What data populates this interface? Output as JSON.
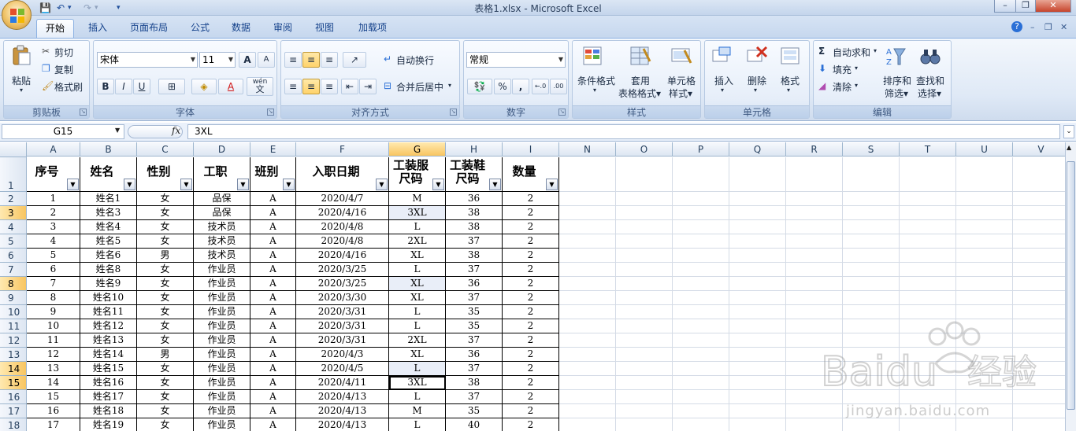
{
  "window": {
    "title": "表格1.xlsx - Microsoft Excel",
    "minimize": "–",
    "restore": "❐",
    "close": "✕",
    "office_icon": "office-logo-icon"
  },
  "qat": {
    "save": "💾",
    "undo": "↶",
    "redo": "↷",
    "more": "▾"
  },
  "tabs": [
    "开始",
    "插入",
    "页面布局",
    "公式",
    "数据",
    "审阅",
    "视图",
    "加载项"
  ],
  "ribbon_right": {
    "help": "?",
    "min": "–",
    "restore": "❐",
    "close": "✕"
  },
  "ribbon": {
    "clipboard": {
      "label": "剪贴板",
      "paste": "粘贴",
      "cut": "剪切",
      "copy": "复制",
      "format_painter": "格式刷"
    },
    "font": {
      "label": "字体",
      "name": "宋体",
      "size": "11",
      "grow": "A",
      "shrink": "A",
      "bold": "B",
      "italic": "I",
      "underline": "U",
      "borders": "⊞",
      "fill": "◈",
      "color": "A",
      "wen": "wén",
      "wen2": "文"
    },
    "alignment": {
      "label": "对齐方式",
      "wrap": "自动换行",
      "merge": "合并后居中"
    },
    "number": {
      "label": "数字",
      "format": "常规",
      "percent": "%",
      "comma": ",",
      "inc": "←.0",
      "dec": ".00"
    },
    "styles": {
      "label": "样式",
      "conditional": [
        "条件格式",
        "▾"
      ],
      "table": [
        "套用",
        "表格格式▾"
      ],
      "cell": [
        "单元格",
        "样式▾"
      ]
    },
    "cells": {
      "label": "单元格",
      "insert": "插入",
      "delete": "删除",
      "format": "格式",
      "arrow": "▾"
    },
    "editing": {
      "label": "编辑",
      "autosum": "自动求和",
      "sigma": "Σ",
      "fill": "填充",
      "clear": "清除",
      "sort": [
        "排序和",
        "筛选▾"
      ],
      "find": [
        "查找和",
        "选择▾"
      ],
      "arrow": "▾"
    }
  },
  "formula_bar": {
    "name_box": "G15",
    "fx": "fx",
    "content": "3XL"
  },
  "columns": [
    "A",
    "B",
    "C",
    "D",
    "E",
    "F",
    "G",
    "H",
    "I",
    "N",
    "O",
    "P",
    "Q",
    "R",
    "S",
    "T",
    "U",
    "V"
  ],
  "table_header": [
    "序号",
    "姓名",
    "性别",
    "工职",
    "班别",
    "入职日期",
    "工装服\n尺码",
    "工装鞋\n尺码",
    "数量"
  ],
  "rows": [
    [
      "1",
      "姓名1",
      "女",
      "品保",
      "A",
      "2020/4/7",
      "M",
      "36",
      "2"
    ],
    [
      "2",
      "姓名3",
      "女",
      "品保",
      "A",
      "2020/4/16",
      "3XL",
      "38",
      "2"
    ],
    [
      "3",
      "姓名4",
      "女",
      "技术员",
      "A",
      "2020/4/8",
      "L",
      "38",
      "2"
    ],
    [
      "4",
      "姓名5",
      "女",
      "技术员",
      "A",
      "2020/4/8",
      "2XL",
      "37",
      "2"
    ],
    [
      "5",
      "姓名6",
      "男",
      "技术员",
      "A",
      "2020/4/16",
      "XL",
      "38",
      "2"
    ],
    [
      "6",
      "姓名8",
      "女",
      "作业员",
      "A",
      "2020/3/25",
      "L",
      "37",
      "2"
    ],
    [
      "7",
      "姓名9",
      "女",
      "作业员",
      "A",
      "2020/3/25",
      "XL",
      "36",
      "2"
    ],
    [
      "8",
      "姓名10",
      "女",
      "作业员",
      "A",
      "2020/3/30",
      "XL",
      "37",
      "2"
    ],
    [
      "9",
      "姓名11",
      "女",
      "作业员",
      "A",
      "2020/3/31",
      "L",
      "35",
      "2"
    ],
    [
      "10",
      "姓名12",
      "女",
      "作业员",
      "A",
      "2020/3/31",
      "L",
      "35",
      "2"
    ],
    [
      "11",
      "姓名13",
      "女",
      "作业员",
      "A",
      "2020/3/31",
      "2XL",
      "37",
      "2"
    ],
    [
      "12",
      "姓名14",
      "男",
      "作业员",
      "A",
      "2020/4/3",
      "XL",
      "36",
      "2"
    ],
    [
      "13",
      "姓名15",
      "女",
      "作业员",
      "A",
      "2020/4/5",
      "L",
      "37",
      "2"
    ],
    [
      "14",
      "姓名16",
      "女",
      "作业员",
      "A",
      "2020/4/11",
      "3XL",
      "38",
      "2"
    ],
    [
      "15",
      "姓名17",
      "女",
      "作业员",
      "A",
      "2020/4/13",
      "L",
      "37",
      "2"
    ],
    [
      "16",
      "姓名18",
      "女",
      "作业员",
      "A",
      "2020/4/13",
      "M",
      "35",
      "2"
    ],
    [
      "17",
      "姓名19",
      "女",
      "作业员",
      "A",
      "2020/4/13",
      "L",
      "40",
      "2"
    ]
  ],
  "row_numbers": [
    "1",
    "2",
    "3",
    "4",
    "5",
    "6",
    "7",
    "8",
    "9",
    "10",
    "11",
    "12",
    "13",
    "14",
    "15",
    "16",
    "17",
    "18"
  ],
  "selected_rows": [
    "3",
    "8",
    "14",
    "15"
  ],
  "selected_column": "G",
  "active_cell": "G15",
  "watermark": {
    "brand": "Baidu",
    "brand2": "经验",
    "url": "jingyan.baidu.com"
  },
  "colors": {
    "accent": "#15428b",
    "selection_header": "#f8c561",
    "selected_cells": "#e9eef8"
  }
}
